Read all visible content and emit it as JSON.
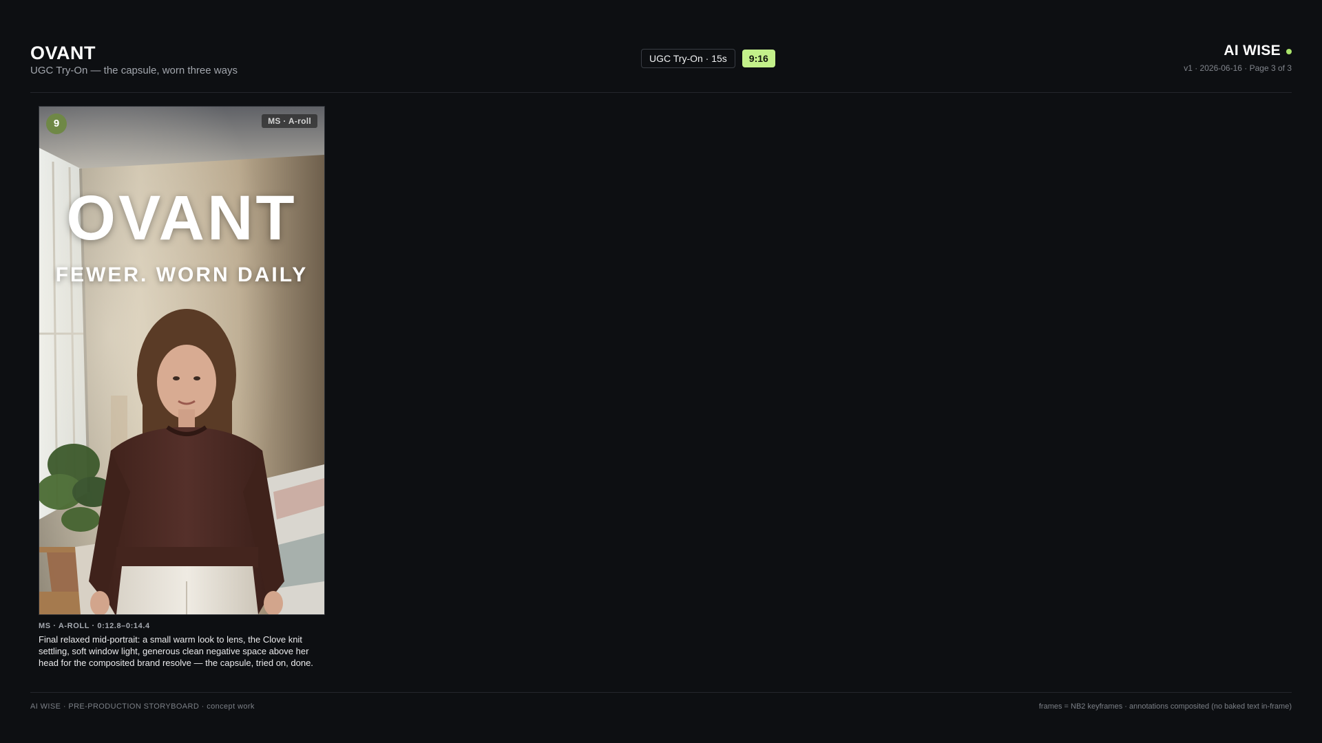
{
  "header": {
    "brand": "OVANT",
    "subtitle": "UGC Try-On — the capsule, worn three ways",
    "format_label": "UGC Try-On · 15s",
    "aspect_label": "9:16",
    "studio": "AI WISE",
    "meta": "v1 · 2026-06-16 · Page 3 of 3"
  },
  "frames": [
    {
      "number": "9",
      "shot_tag": "MS · A-roll",
      "overlay_title": "OVANT",
      "overlay_tagline": "FEWER. WORN DAILY",
      "caption_label": "MS · A-ROLL · 0:12.8–0:14.4",
      "caption_text": "Final relaxed mid-portrait: a small warm look to lens, the Clove knit settling, soft window light, generous clean negative space above her head for the composited brand resolve — the capsule, tried on, done."
    }
  ],
  "footer": {
    "left": "AI WISE · PRE-PRODUCTION STORYBOARD · concept work",
    "right": "frames = NB2 keyframes · annotations composited (no baked text in-frame)"
  },
  "colors": {
    "background": "#0d0f12",
    "accent": "#c3f08a",
    "badge": "#6f8846",
    "sweater": "#4f2b22"
  }
}
